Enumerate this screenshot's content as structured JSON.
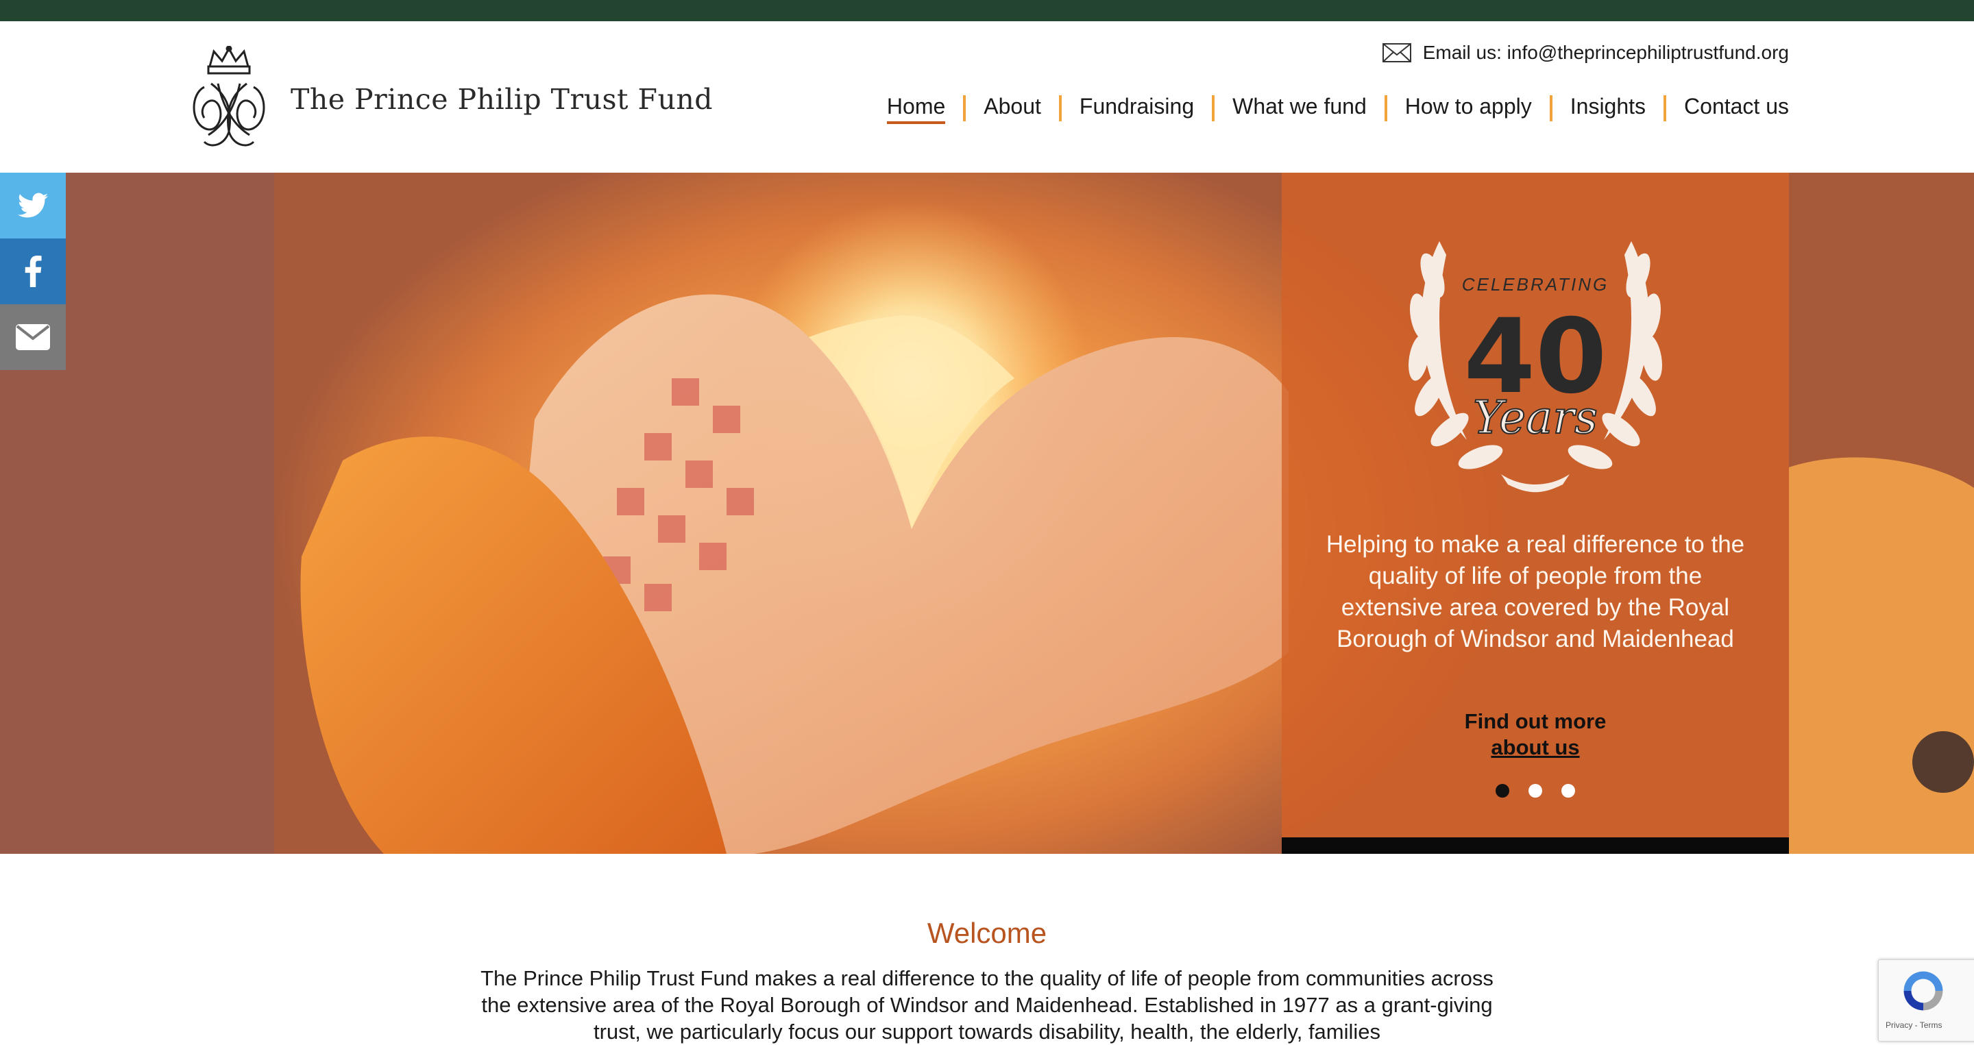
{
  "site": {
    "name": "The Prince Philip Trust Fund",
    "email_label": "Email us: info@theprincephiliptrustfund.org"
  },
  "nav": {
    "items": [
      {
        "label": "Home",
        "active": true
      },
      {
        "label": "About"
      },
      {
        "label": "Fundraising"
      },
      {
        "label": "What we fund"
      },
      {
        "label": "How to apply"
      },
      {
        "label": "Insights"
      },
      {
        "label": "Contact us"
      }
    ]
  },
  "social": {
    "icons": [
      "twitter-icon",
      "facebook-icon",
      "envelope-icon"
    ],
    "colors": {
      "twitter": "#58b5e9",
      "facebook": "#2b76b6",
      "email": "#7a7a7a"
    }
  },
  "hero": {
    "badge_top": "CELEBRATING",
    "badge_number": "40",
    "badge_word": "Years",
    "tagline": "Helping to make a real difference to the quality of life of people from the extensive area covered by the Royal Borough of Windsor and Maidenhead",
    "cta_line1": "Find out more",
    "cta_line2": "about us",
    "slides": 3,
    "active_slide": 1
  },
  "welcome": {
    "title": "Welcome",
    "body": "The Prince Philip Trust Fund makes a real difference to the quality of life of people from communities across the extensive area of the Royal Borough of Windsor and Maidenhead. Established in 1977 as a grant-giving trust, we particularly focus our support towards disability, health, the elderly, families"
  },
  "recaptcha": {
    "footer": "Privacy - Terms"
  },
  "theme": {
    "top_bar": "#23442f",
    "accent": "#c75a1a",
    "nav_divider": "#f2a33a",
    "panel": "#d36228"
  }
}
